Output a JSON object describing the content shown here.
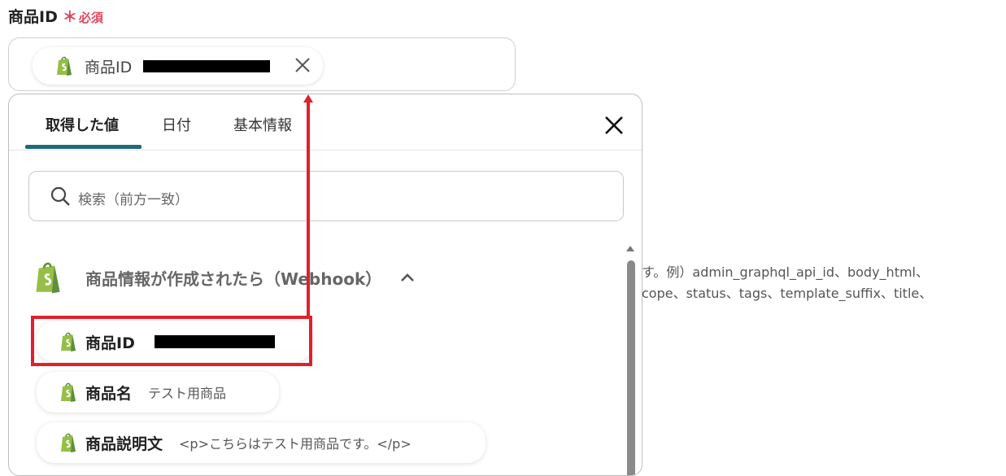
{
  "field": {
    "label": "商品ID",
    "required_star": "＊",
    "required_text": "必須"
  },
  "selected_chip": {
    "label": "商品ID"
  },
  "panel": {
    "tabs": [
      {
        "label": "取得した値",
        "active": true
      },
      {
        "label": "日付",
        "active": false
      },
      {
        "label": "基本情報",
        "active": false
      }
    ],
    "search_placeholder": "検索（前方一致）",
    "group": {
      "title": "商品情報が作成されたら（Webhook）",
      "icon": "shopify-icon",
      "expanded": true
    },
    "items": [
      {
        "label": "商品ID",
        "value": ""
      },
      {
        "label": "商品名",
        "value": "テスト用商品"
      },
      {
        "label": "商品説明文",
        "value": "<p>こちらはテスト用商品です。</p>"
      }
    ]
  },
  "background_help": [
    "す。例）admin_graphql_api_id、body_html、",
    "cope、status、tags、template_suffix、title、"
  ],
  "colors": {
    "accent_tab": "#1f6a78",
    "required": "#e0455c",
    "annotation_red": "#e0202c",
    "shopify_green": "#95bf47"
  }
}
